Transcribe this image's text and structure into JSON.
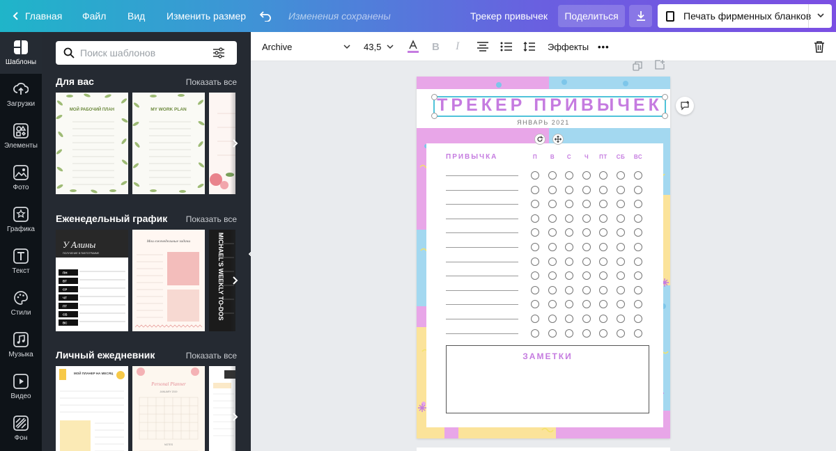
{
  "topbar": {
    "home": "Главная",
    "file": "Файл",
    "view": "Вид",
    "resize": "Изменить размер",
    "saved_status": "Изменения сохранены",
    "doc_title": "Трекер привычек",
    "share": "Поделиться",
    "print": "Печать фирменных бланков"
  },
  "rail": {
    "items": [
      {
        "label": "Шаблоны",
        "icon": "templates-icon"
      },
      {
        "label": "Загрузки",
        "icon": "upload-icon"
      },
      {
        "label": "Элементы",
        "icon": "elements-icon"
      },
      {
        "label": "Фото",
        "icon": "photo-icon"
      },
      {
        "label": "Графика",
        "icon": "graphics-icon"
      },
      {
        "label": "Текст",
        "icon": "text-icon"
      },
      {
        "label": "Стили",
        "icon": "palette-icon"
      },
      {
        "label": "Музыка",
        "icon": "music-icon"
      },
      {
        "label": "Видео",
        "icon": "video-icon"
      },
      {
        "label": "Фон",
        "icon": "background-icon"
      }
    ]
  },
  "panel": {
    "search_placeholder": "Поиск шаблонов",
    "show_all": "Показать все",
    "sections": [
      {
        "title": "Для вас"
      },
      {
        "title": "Еженедельный график"
      },
      {
        "title": "Личный ежедневник"
      }
    ],
    "thumbs": {
      "t1_title": "МОЙ РАБОЧИЙ ПЛАН",
      "t2_title": "MY WORK PLAN",
      "t3_title": "У Алины",
      "t3_sub": "ПОЛУЧЕНИЕ В ПИКТОГРАММЕ",
      "t3_days": [
        "ПН",
        "ВТ",
        "СР",
        "ЧТ",
        "ПТ",
        "СБ",
        "ВС"
      ],
      "t4_title": "Мои еженедельные задачи",
      "t5_title": "MICHAEL'S WEEKLY TO-DOS",
      "t6_title": "МОЙ ПЛАНЕР НА МЕСЯЦ",
      "t7_title": "Personal Planner",
      "t7_sub": "JANUARY 2019",
      "t7_notes": "NOTES"
    }
  },
  "toolbar": {
    "font": "Archive",
    "size": "43,5",
    "effects": "Эффекты",
    "more": "•••"
  },
  "design": {
    "title": "ТРЕКЕР ПРИВЫЧЕК",
    "subtitle": "ЯНВАРЬ 2021",
    "habit_header": "ПРИВЫЧКА",
    "days": [
      "П",
      "В",
      "С",
      "Ч",
      "ПТ",
      "СБ",
      "ВС"
    ],
    "rows": 12,
    "notes": "ЗАМЕТКИ"
  },
  "colors": {
    "accent_pink": "#c57be0",
    "pink_bg": "#e8a6e8",
    "blue_bg": "#a3d8f0",
    "yellow_bg": "#fbe39a",
    "selection": "#4fc3d9"
  }
}
